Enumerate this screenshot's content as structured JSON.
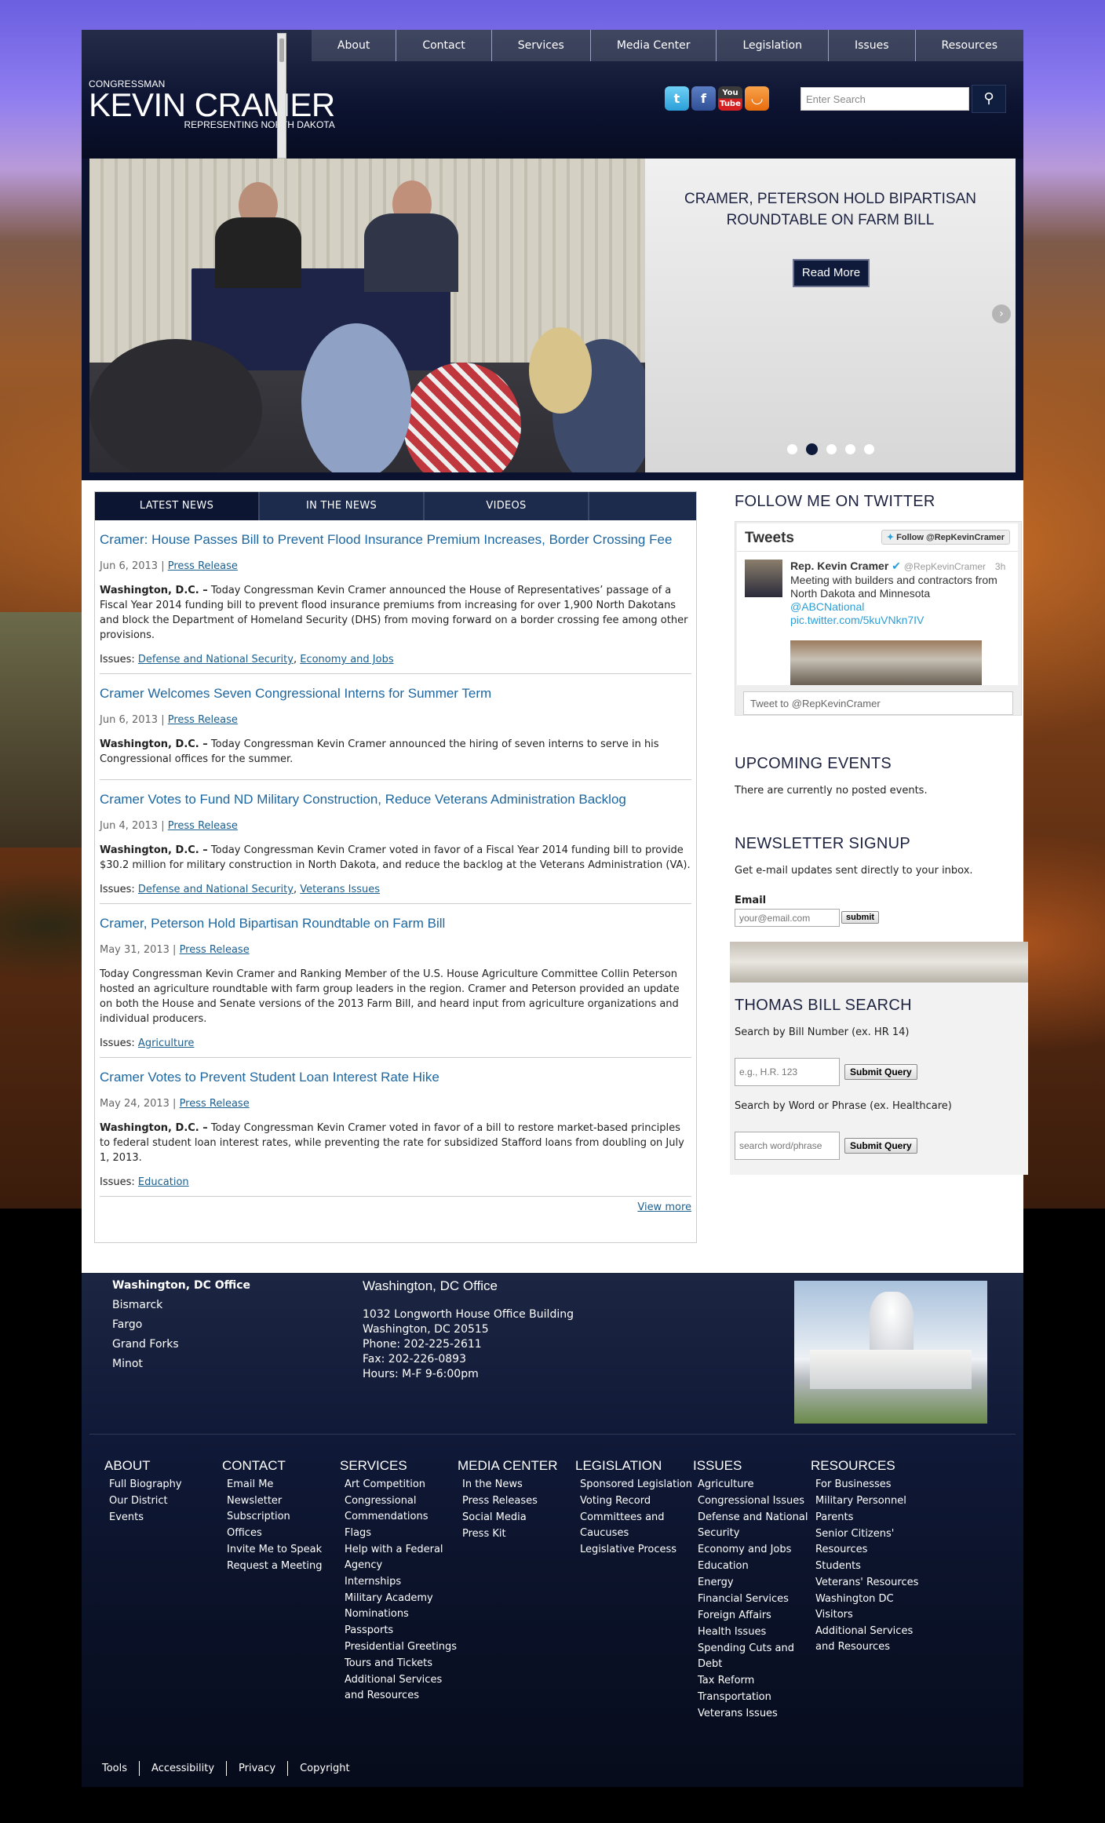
{
  "nav": {
    "items": [
      "About",
      "Contact",
      "Services",
      "Media Center",
      "Legislation",
      "Issues",
      "Resources"
    ]
  },
  "logo": {
    "small": "CONGRESSMAN",
    "big": "KEVIN CRAMER",
    "sub": "REPRESENTING NORTH DAKOTA"
  },
  "social": [
    "twitter-icon",
    "facebook-icon",
    "youtube-icon",
    "rss-icon"
  ],
  "search": {
    "placeholder": "Enter Search"
  },
  "slider": {
    "headline": "CRAMER, PETERSON HOLD BIPARTISAN ROUNDTABLE ON FARM BILL",
    "button": "Read More",
    "active_dot": 2,
    "dot_count": 5
  },
  "tabs": [
    "LATEST NEWS",
    "IN THE NEWS",
    "VIDEOS"
  ],
  "news": [
    {
      "title": "Cramer: House Passes Bill to Prevent Flood Insurance Premium Increases, Border Crossing Fee",
      "date": "Jun 6, 2013",
      "type": "Press Release",
      "lead": "Washington, D.C. –",
      "body": " Today Congressman Kevin Cramer announced the House of Representatives’ passage of a Fiscal Year 2014 funding bill to prevent flood insurance premiums from increasing for over 1,900 North Dakotans and block the Department of Homeland Security (DHS) from moving forward on a border crossing fee among other provisions.",
      "issues_label": "Issues:",
      "issues": [
        "Defense and National Security",
        "Economy and Jobs"
      ]
    },
    {
      "title": "Cramer Welcomes Seven Congressional Interns for Summer Term",
      "date": "Jun 6, 2013",
      "type": "Press Release",
      "lead": "Washington, D.C. –",
      "body": " Today Congressman Kevin Cramer announced the hiring of seven interns to serve in his Congressional offices for the summer.",
      "issues_label": "",
      "issues": []
    },
    {
      "title": "Cramer Votes to Fund ND Military Construction, Reduce Veterans Administration Backlog",
      "date": "Jun 4, 2013",
      "type": "Press Release",
      "lead": "Washington, D.C. –",
      "body": " Today Congressman Kevin Cramer voted in favor of a Fiscal Year 2014 funding bill to provide $30.2 million for military construction in North Dakota, and reduce the backlog at the Veterans Administration (VA).",
      "issues_label": "Issues:",
      "issues": [
        "Defense and National Security",
        "Veterans Issues"
      ]
    },
    {
      "title": "Cramer, Peterson Hold Bipartisan Roundtable on Farm Bill",
      "date": "May 31, 2013",
      "type": "Press Release",
      "lead": "",
      "body": "Today Congressman Kevin Cramer and Ranking Member of the U.S. House Agriculture Committee Collin Peterson hosted an agriculture roundtable with farm group leaders in the region. Cramer and Peterson provided an update on both the House and Senate versions of the 2013 Farm Bill, and heard input from agriculture organizations and individual producers.",
      "issues_label": "Issues:",
      "issues": [
        "Agriculture"
      ]
    },
    {
      "title": "Cramer Votes to Prevent Student Loan Interest Rate Hike",
      "date": "May 24, 2013",
      "type": "Press Release",
      "lead": "Washington, D.C. –",
      "body": " Today Congressman Kevin Cramer voted in favor of a bill to restore market-based principles to federal student loan interest rates, while preventing the rate for subsidized Stafford loans from doubling on July 1, 2013.",
      "issues_label": "Issues:",
      "issues": [
        "Education"
      ]
    }
  ],
  "viewmore": "View more",
  "twitter": {
    "heading": "FOLLOW ME ON TWITTER",
    "tweets_label": "Tweets",
    "follow": "Follow @RepKevinCramer",
    "name": "Rep. Kevin Cramer",
    "handle": "@RepKevinCramer",
    "time": "3h",
    "text": "Meeting with builders and contractors from North Dakota and Minnesota",
    "mention": "@ABCNational",
    "link": "pic.twitter.com/5kuVNkn7IV",
    "input_placeholder": "Tweet to @RepKevinCramer"
  },
  "events": {
    "heading": "UPCOMING EVENTS",
    "text": "There are currently no posted events."
  },
  "newsletter": {
    "heading": "NEWSLETTER SIGNUP",
    "text": "Get e-mail updates sent directly to your inbox.",
    "label": "Email",
    "placeholder": "your@email.com",
    "submit": "submit"
  },
  "thomas": {
    "heading": "THOMAS BILL SEARCH",
    "by_number": "Search by Bill Number (ex. HR 14)",
    "number_placeholder": "e.g., H.R. 123",
    "submit": "Submit Query",
    "by_word": "Search by Word or Phrase (ex. Healthcare)",
    "word_placeholder": "search word/phrase"
  },
  "footer": {
    "offices": [
      "Washington, DC Office",
      "Bismarck",
      "Fargo",
      "Grand Forks",
      "Minot"
    ],
    "office": {
      "title": "Washington, DC Office",
      "line1": "1032 Longworth House Office Building",
      "line2": "Washington, DC 20515",
      "phone": "Phone: 202-225-2611",
      "fax": "Fax: 202-226-0893",
      "hours": "Hours: M-F 9-6:00pm"
    },
    "columns": [
      {
        "title": "ABOUT",
        "links": [
          "Full Biography",
          "Our District",
          "Events"
        ]
      },
      {
        "title": "CONTACT",
        "links": [
          "Email Me",
          "Newsletter Subscription",
          "Offices",
          "Invite Me to Speak",
          "Request a Meeting"
        ]
      },
      {
        "title": "SERVICES",
        "links": [
          "Art Competition",
          "Congressional Commendations",
          "Flags",
          "Help with a Federal Agency",
          "Internships",
          "Military Academy Nominations",
          "Passports",
          "Presidential Greetings",
          "Tours and Tickets",
          "Additional Services and Resources"
        ]
      },
      {
        "title": "MEDIA CENTER",
        "links": [
          "In the News",
          "Press Releases",
          "Social Media",
          "Press Kit"
        ]
      },
      {
        "title": "LEGISLATION",
        "links": [
          "Sponsored Legislation",
          "Voting Record",
          "Committees and Caucuses",
          "Legislative Process"
        ]
      },
      {
        "title": "ISSUES",
        "links": [
          "Agriculture",
          "Congressional Issues",
          "Defense and National Security",
          "Economy and Jobs",
          "Education",
          "Energy",
          "Financial Services",
          "Foreign Affairs",
          "Health Issues",
          "Spending Cuts and Debt",
          "Tax Reform",
          "Transportation",
          "Veterans Issues"
        ]
      },
      {
        "title": "RESOURCES",
        "links": [
          "For Businesses",
          "Military Personnel",
          "Parents",
          "Senior Citizens' Resources",
          "Students",
          "Veterans' Resources",
          "Washington DC Visitors",
          "Additional Services and Resources"
        ]
      }
    ],
    "bottom": [
      "Tools",
      "Accessibility",
      "Privacy",
      "Copyright"
    ]
  }
}
